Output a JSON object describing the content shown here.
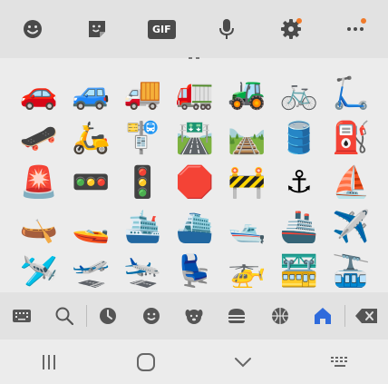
{
  "toolbar": {
    "items": [
      {
        "name": "emoji-icon"
      },
      {
        "name": "sticker-icon"
      },
      {
        "name": "gif-icon",
        "label": "GIF"
      },
      {
        "name": "microphone-icon"
      },
      {
        "name": "settings-icon",
        "badge": true
      },
      {
        "name": "more-icon",
        "badge": true
      }
    ],
    "accent_color": "#f07a2a"
  },
  "emoji_grid": {
    "category": "travel-and-places",
    "rows": [
      [
        "🚗",
        "🚙",
        "🚚",
        "🚛",
        "🚜",
        "🚲",
        "🛴"
      ],
      [
        "🛹",
        "🛵",
        "🚏",
        "🛣️",
        "🛤️",
        "🛢️",
        "⛽"
      ],
      [
        "🚨",
        "🚥",
        "🚦",
        "🛑",
        "🚧",
        "⚓",
        "⛵"
      ],
      [
        "🛶",
        "🚤",
        "🛳️",
        "⛴️",
        "🛥️",
        "🚢",
        "✈️"
      ],
      [
        "🛩️",
        "🛫",
        "🛬",
        "💺",
        "🚁",
        "🚟",
        "🚠"
      ]
    ]
  },
  "category_bar": {
    "items": [
      {
        "name": "keyboard-icon"
      },
      {
        "name": "search-icon"
      },
      {
        "name": "recent-icon"
      },
      {
        "name": "smiley-icon"
      },
      {
        "name": "animals-icon"
      },
      {
        "name": "food-icon"
      },
      {
        "name": "activity-icon"
      },
      {
        "name": "travel-icon",
        "active": true
      },
      {
        "name": "backspace-icon"
      }
    ],
    "active_color": "#2f6bdc"
  },
  "nav_bar": {
    "items": [
      {
        "name": "recent-apps-icon"
      },
      {
        "name": "home-icon"
      },
      {
        "name": "hide-keyboard-icon"
      },
      {
        "name": "keyboard-switch-icon"
      }
    ]
  }
}
